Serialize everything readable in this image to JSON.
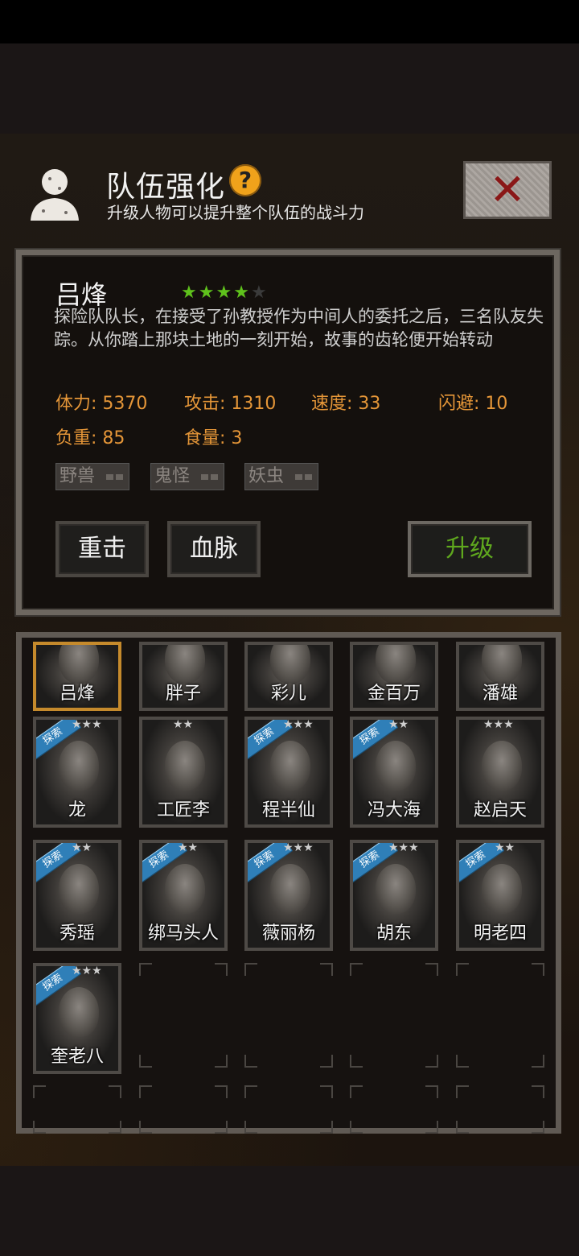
{
  "header": {
    "title": "队伍强化",
    "help_icon_label": "?",
    "subtitle": "升级人物可以提升整个队伍的战斗力",
    "close_label": "✕"
  },
  "hero": {
    "name": "吕烽",
    "stars_filled": 4,
    "stars_total": 5,
    "description": "探险队队长，在接受了孙教授作为中间人的委托之后，三名队友失踪。从你踏上那块土地的一刻开始，故事的齿轮便开始转动",
    "stats": {
      "hp": "体力: 5370",
      "attack": "攻击: 1310",
      "speed": "速度: 33",
      "dodge": "闪避: 10",
      "load": "负重: 85",
      "food": "食量: 3"
    },
    "tags": [
      "野兽",
      "鬼怪",
      "妖虫"
    ],
    "buttons": {
      "heavy_strike": "重击",
      "bloodline": "血脉",
      "upgrade": "升级"
    }
  },
  "roster": {
    "explore_badge": "探索",
    "characters": [
      {
        "name": "吕烽",
        "selected": true
      },
      {
        "name": "胖子"
      },
      {
        "name": "彩儿"
      },
      {
        "name": "金百万"
      },
      {
        "name": "潘雄"
      },
      {
        "name": "龙",
        "stars": "★★★"
      },
      {
        "name": "工匠李",
        "stars": "★★"
      },
      {
        "name": "程半仙",
        "stars": "★★★"
      },
      {
        "name": "冯大海",
        "stars": "★★"
      },
      {
        "name": "赵启天",
        "stars": "★★★"
      },
      {
        "name": "秀瑶",
        "stars": "★★"
      },
      {
        "name": "绑马头人",
        "stars": "★★"
      },
      {
        "name": "薇丽杨",
        "stars": "★★★"
      },
      {
        "name": "胡东",
        "stars": "★★★"
      },
      {
        "name": "明老四",
        "stars": "★★"
      },
      {
        "name": "奎老八",
        "stars": "★★★"
      }
    ]
  },
  "colors": {
    "stat_orange": "#e59638",
    "star_green": "#5fc21c",
    "upgrade_green": "#5fa81e",
    "help_yellow": "#f0a21b",
    "badge_blue": "#2f7fb8"
  }
}
